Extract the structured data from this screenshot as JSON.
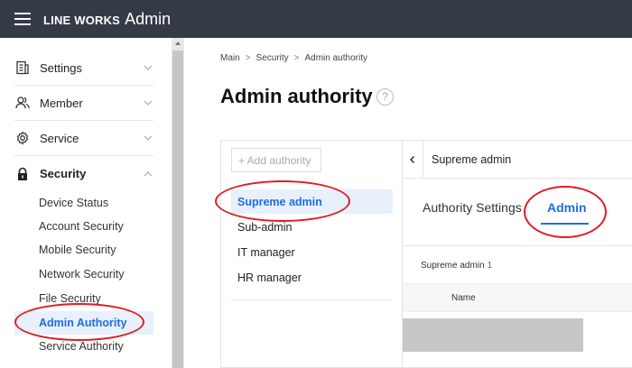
{
  "app": {
    "logo": "LINE WORKS",
    "title": "Admin"
  },
  "sidebar": {
    "items": [
      {
        "label": "Settings"
      },
      {
        "label": "Member"
      },
      {
        "label": "Service"
      },
      {
        "label": "Security"
      }
    ],
    "security_sub": [
      {
        "label": "Device Status"
      },
      {
        "label": "Account Security"
      },
      {
        "label": "Mobile Security"
      },
      {
        "label": "Network Security"
      },
      {
        "label": "File Security"
      },
      {
        "label": "Admin Authority"
      },
      {
        "label": "Service Authority"
      }
    ]
  },
  "breadcrumb": [
    "Main",
    "Security",
    "Admin authority"
  ],
  "page": {
    "title": "Admin authority",
    "help": "?"
  },
  "authority_list": {
    "add_button": "+ Add authority",
    "items": [
      "Supreme admin",
      "Sub-admin",
      "IT manager",
      "HR manager"
    ]
  },
  "detail": {
    "header": "Supreme admin",
    "tabs": [
      "Authority Settings",
      "Admin"
    ],
    "count_label": "Supreme admin",
    "count": "1",
    "column_name": "Name"
  },
  "colors": {
    "accent": "#1e6ee6",
    "annotation": "#e01b24",
    "topbar": "#343a46"
  }
}
